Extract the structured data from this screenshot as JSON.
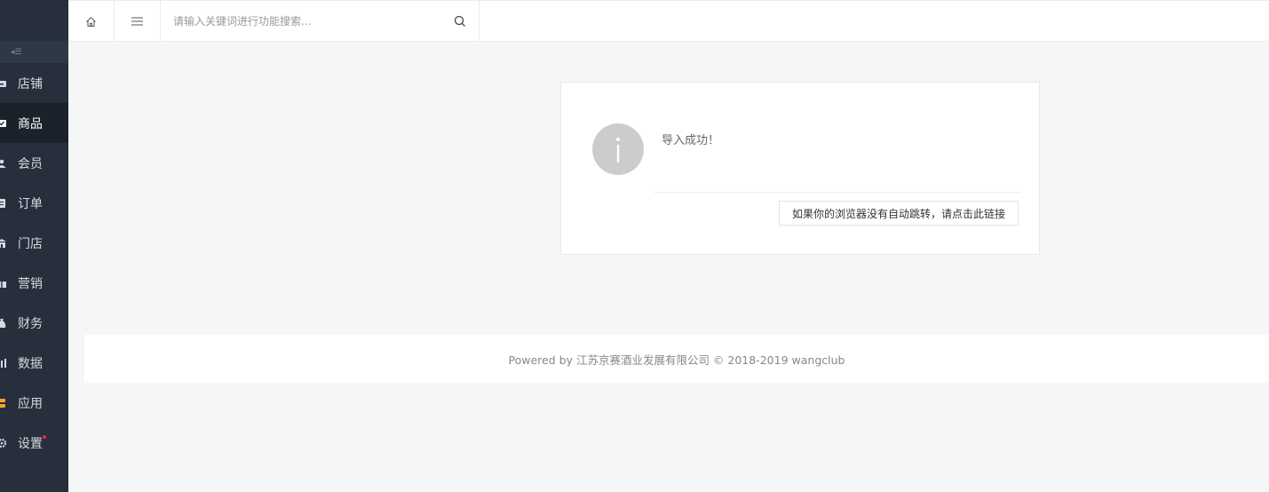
{
  "sidebar": {
    "items": [
      {
        "label": "店铺",
        "icon": "shop-icon",
        "active": false
      },
      {
        "label": "商品",
        "icon": "goods-icon",
        "active": true
      },
      {
        "label": "会员",
        "icon": "user-icon",
        "active": false
      },
      {
        "label": "订单",
        "icon": "order-icon",
        "active": false
      },
      {
        "label": "门店",
        "icon": "store-icon",
        "active": false
      },
      {
        "label": "营销",
        "icon": "gift-icon",
        "active": false
      },
      {
        "label": "财务",
        "icon": "finance-icon",
        "active": false
      },
      {
        "label": "数据",
        "icon": "chart-icon",
        "active": false
      },
      {
        "label": "应用",
        "icon": "app-icon",
        "active": false
      },
      {
        "label": "设置",
        "icon": "gear-icon",
        "active": false
      }
    ]
  },
  "topbar": {
    "search_placeholder": "请输入关键词进行功能搜索..."
  },
  "message": {
    "text": "导入成功！",
    "link_label": "如果你的浏览器没有自动跳转，请点击此链接"
  },
  "footer": {
    "text": "Powered by 江苏京赛酒业发展有限公司 © 2018-2019 wangclub"
  },
  "colors": {
    "sidebar_bg": "#262f3b",
    "sidebar_active_bg": "#1b222c",
    "accent_orange": "#f5a623",
    "badge_red": "#e52d2d"
  }
}
